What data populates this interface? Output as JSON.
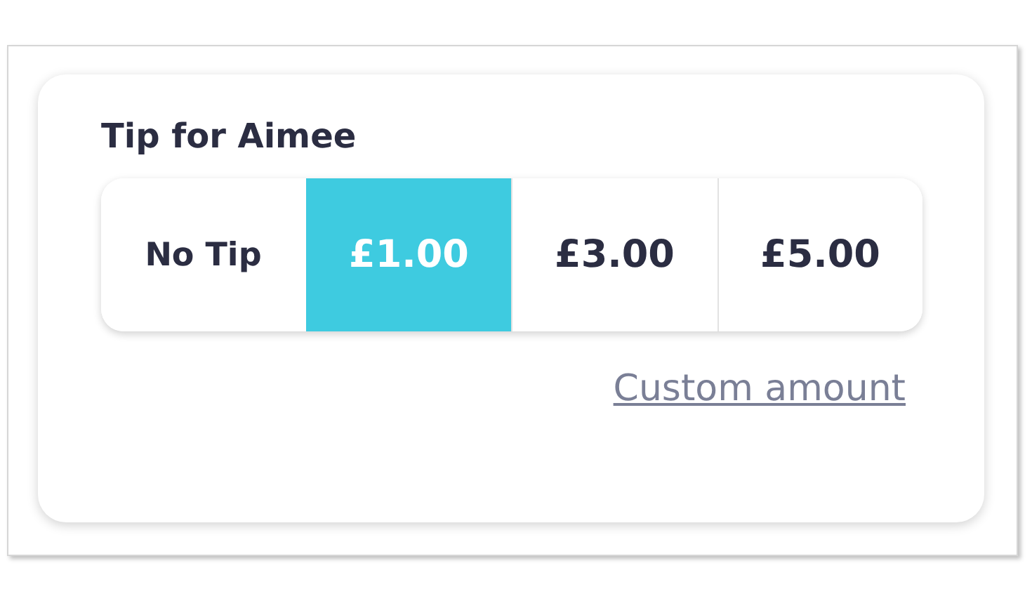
{
  "title": "Tip for Aimee",
  "options": [
    {
      "label": "No Tip",
      "selected": false
    },
    {
      "label": "£1.00",
      "selected": true
    },
    {
      "label": "£3.00",
      "selected": false
    },
    {
      "label": "£5.00",
      "selected": false
    }
  ],
  "custom_link": "Custom amount"
}
